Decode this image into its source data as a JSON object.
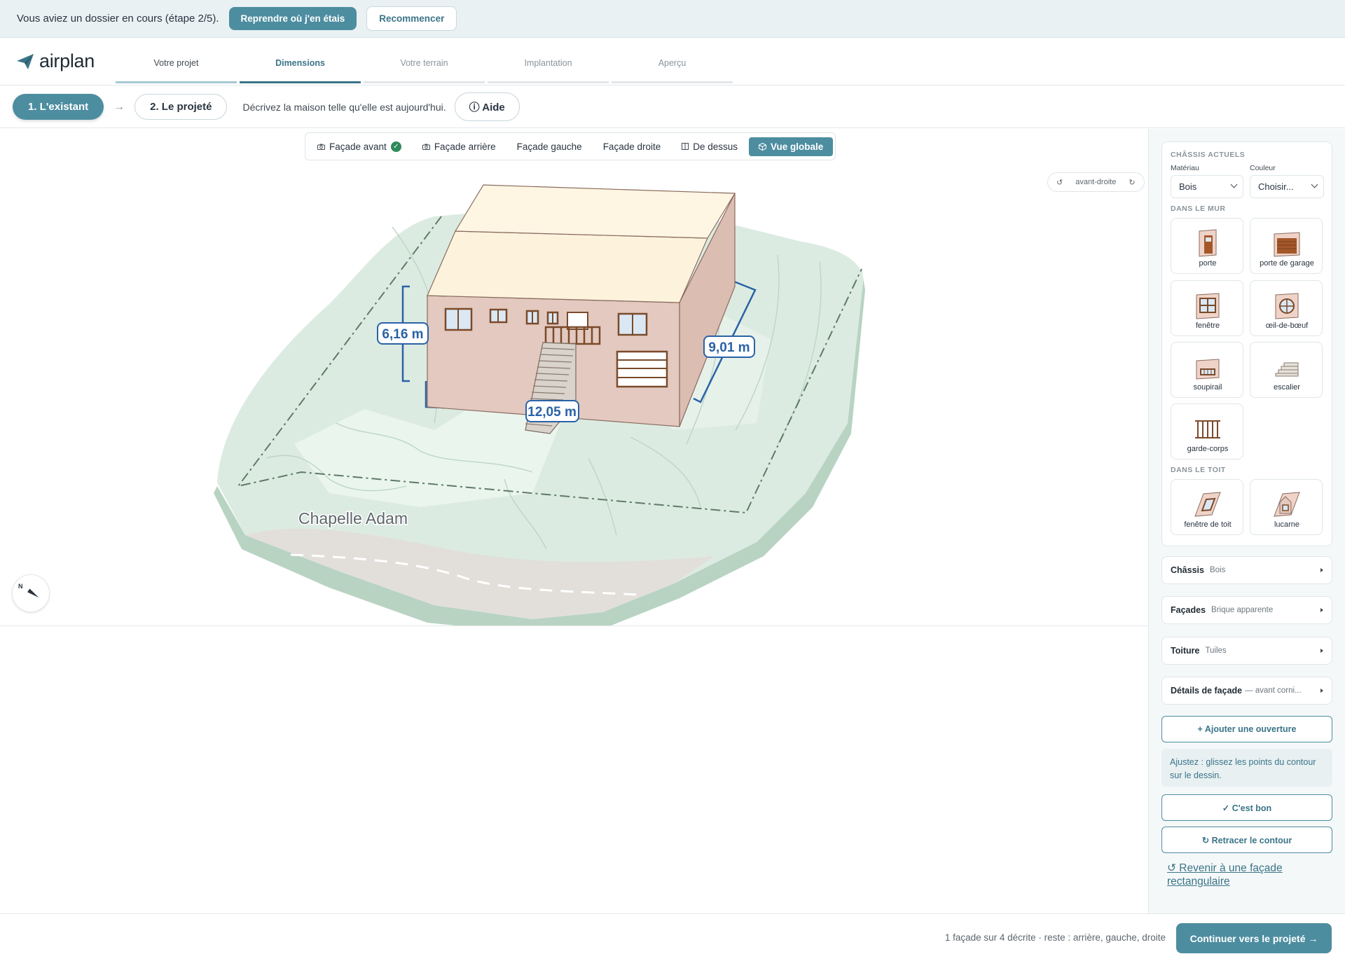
{
  "resume_bar": {
    "message": "Vous aviez un dossier en cours (étape 2/5).",
    "resume_button": "Reprendre où j'en étais",
    "restart_button": "Recommencer"
  },
  "brand": {
    "name": "airplan"
  },
  "steps": [
    {
      "label": "Votre projet",
      "state": "done"
    },
    {
      "label": "Dimensions",
      "state": "active"
    },
    {
      "label": "Votre terrain",
      "state": "todo"
    },
    {
      "label": "Implantation",
      "state": "todo"
    },
    {
      "label": "Aperçu",
      "state": "todo"
    }
  ],
  "subbar": {
    "existing": "1. L'existant",
    "arrow": "→",
    "project": "2. Le projeté",
    "description": "Décrivez la maison telle qu'elle est aujourd'hui.",
    "help": "ⓘ Aide"
  },
  "view_tabs": [
    {
      "label": "Façade avant",
      "icon": "camera-icon",
      "checked": true
    },
    {
      "label": "Façade arrière",
      "icon": "camera-icon"
    },
    {
      "label": "Façade gauche"
    },
    {
      "label": "Façade droite"
    },
    {
      "label": "De dessus",
      "icon": "plan-icon"
    },
    {
      "label": "Vue globale",
      "icon": "cube-icon",
      "active": true
    }
  ],
  "view_control": {
    "rotate_left": "↺",
    "label": "avant-droite",
    "rotate_right": "↻"
  },
  "scene": {
    "dimensions": {
      "height": "6,16 m",
      "depth": "9,01 m",
      "width": "12,05 m"
    },
    "place_name": "Chapelle Adam",
    "compass_label": "N",
    "colors": {
      "terrain": "#dcebe2",
      "wall": "#e3c9bf",
      "roof": "#fdf3dd",
      "dimension": "#2a62a6",
      "frames": "#7a4a2a"
    }
  },
  "panel": {
    "chassis_title": "CHÂSSIS ACTUELS",
    "material_label": "Matériau",
    "material_value": "Bois",
    "color_label": "Couleur",
    "color_value": "Choisir...",
    "wall_title": "DANS LE MUR",
    "wall_items": [
      {
        "label": "porte",
        "icon": "door-icon"
      },
      {
        "label": "porte de garage",
        "icon": "garage-door-icon"
      },
      {
        "label": "fenêtre",
        "icon": "window-icon"
      },
      {
        "label": "œil-de-bœuf",
        "icon": "round-window-icon"
      },
      {
        "label": "soupirail",
        "icon": "basement-window-icon"
      },
      {
        "label": "escalier",
        "icon": "stairs-icon"
      },
      {
        "label": "garde-corps",
        "icon": "railing-icon"
      }
    ],
    "roof_title": "DANS LE TOIT",
    "roof_items": [
      {
        "label": "fenêtre de toit",
        "icon": "roof-window-icon"
      },
      {
        "label": "lucarne",
        "icon": "dormer-icon"
      }
    ],
    "accordions": [
      {
        "title": "Châssis",
        "value": "Bois"
      },
      {
        "title": "Façades",
        "value": "Brique apparente"
      },
      {
        "title": "Toiture",
        "value": "Tuiles"
      },
      {
        "title": "Détails de façade",
        "value": "— avant  corni..."
      }
    ],
    "add_opening": "+ Ajouter une ouverture",
    "hint": "Ajustez : glissez les points du contour sur le dessin.",
    "confirm": "✓ C'est bon",
    "retrace": "↻ Retracer le contour",
    "revert": "↺ Revenir à une façade rectangulaire"
  },
  "footer": {
    "status": "1 façade sur 4 décrite · reste : arrière, gauche, droite",
    "continue": "Continuer vers le projeté →"
  }
}
